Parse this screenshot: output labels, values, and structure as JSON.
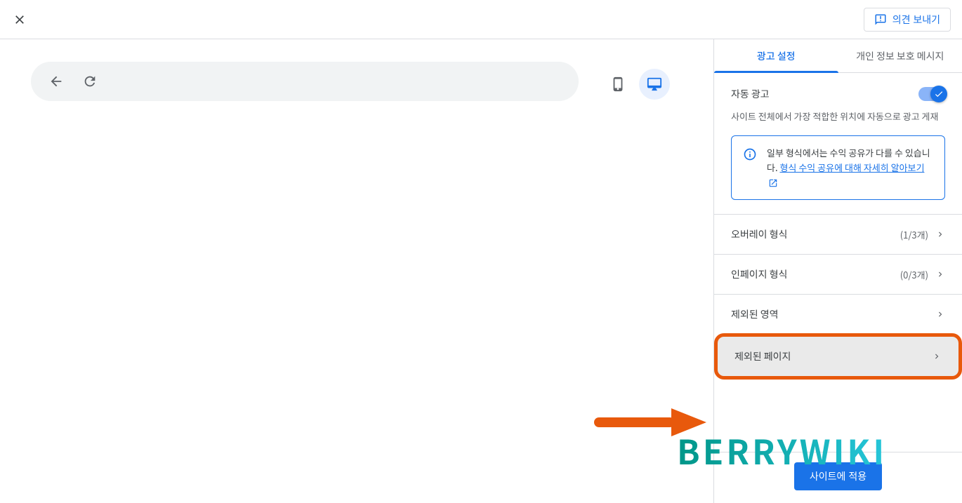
{
  "topbar": {
    "feedback_label": "의견 보내기"
  },
  "sidebar": {
    "tabs": {
      "ad_settings": "광고 설정",
      "privacy_msgs": "개인 정보 보호 메시지"
    },
    "auto_ads": {
      "label": "자동 광고",
      "description": "사이트 전체에서 가장 적합한 위치에 자동으로 광고 게재",
      "toggle_on": true
    },
    "info": {
      "text_prefix": "일부 형식에서는 수익 공유가 다를 수 있습니다. ",
      "link_text": "형식 수익 공유에 대해 자세히 알아보기"
    },
    "items": [
      {
        "label": "오버레이 형식",
        "count": "(1/3개)",
        "has_count": true
      },
      {
        "label": "인페이지 형식",
        "count": "(0/3개)",
        "has_count": true
      },
      {
        "label": "제외된 영역",
        "count": "",
        "has_count": false
      },
      {
        "label": "제외된 페이지",
        "count": "",
        "has_count": false,
        "highlighted": true
      }
    ],
    "apply_label": "사이트에 적용"
  },
  "watermark": "BERRYWIKI"
}
